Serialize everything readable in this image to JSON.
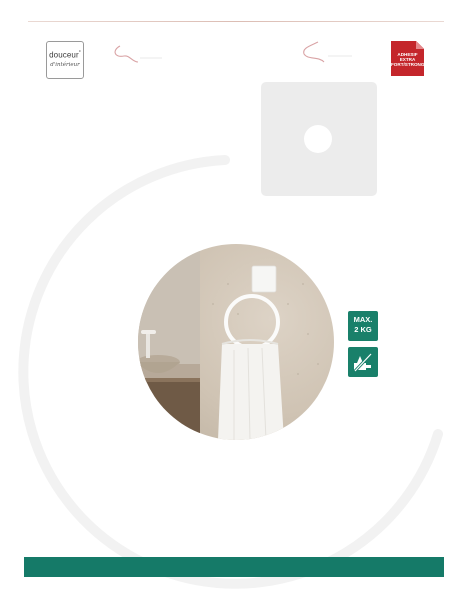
{
  "brand": {
    "name": "douceur",
    "name_mark": "°",
    "sub": "d'intérieur"
  },
  "adhesive_badge": {
    "line1": "ADHESIF",
    "line2": "EXTRA",
    "line3": "FORT/STRONG",
    "color": "#c4262b"
  },
  "features": {
    "max_weight_line1": "MAX.",
    "max_weight_line2": "2 KG",
    "no_drill_icon": "no-drill-icon",
    "color": "#19806a"
  },
  "footer": {
    "color": "#157a68"
  },
  "colors": {
    "accent_green": "#19806a",
    "accent_red": "#c4262b",
    "plate_gray": "#ececec"
  }
}
